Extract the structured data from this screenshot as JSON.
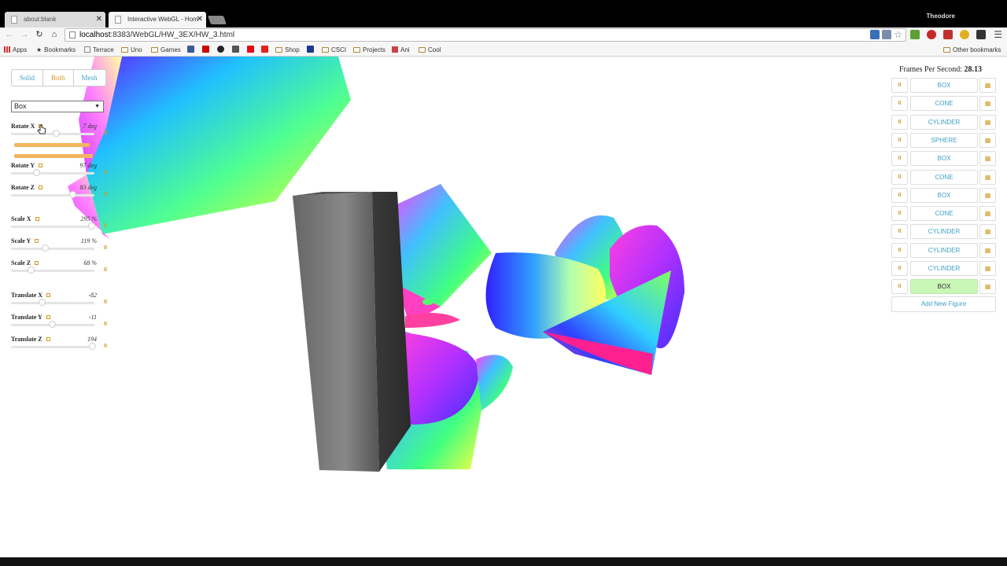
{
  "browser": {
    "tabs": [
      {
        "title": "about:blank",
        "active": false
      },
      {
        "title": "Interactive WebGL - Hom",
        "active": true
      }
    ],
    "user": "Theodore",
    "url_host": "localhost",
    "url_rest": ":8383/WebGL/HW_3EX/HW_3.html",
    "bookmarks": [
      "Apps",
      "Bookmarks",
      "Terrace",
      "Uno",
      "Games",
      "Shop",
      "CSCI",
      "Projects",
      "Ani",
      "Cool"
    ],
    "other_bookmarks": "Other bookmarks"
  },
  "controls": {
    "modes": [
      "Solid",
      "Both",
      "Mesh"
    ],
    "active_mode": "Both",
    "shape_select": "Box",
    "sliders": [
      {
        "label": "Rotate X",
        "value": "7 deg",
        "level": 0.52
      },
      {
        "label": "Rotate Y",
        "value": "97 deg",
        "level": 0.27
      },
      {
        "label": "Rotate Z",
        "value": "83 deg",
        "level": 0.73
      },
      {
        "label": "Scale X",
        "value": "295 %",
        "level": 0.96
      },
      {
        "label": "Scale Y",
        "value": "119 %",
        "level": 0.38
      },
      {
        "label": "Scale Z",
        "value": "68 %",
        "level": 0.21
      },
      {
        "label": "Translate X",
        "value": "-82",
        "level": 0.34
      },
      {
        "label": "Translate Y",
        "value": "-11",
        "level": 0.47
      },
      {
        "label": "Translate Z",
        "value": "194",
        "level": 0.97
      }
    ]
  },
  "right_panel": {
    "fps_label": "Frames Per Second:",
    "fps_value": "28.13",
    "figures": [
      "BOX",
      "CONE",
      "CYLINDER",
      "SPHERE",
      "BOX",
      "CONE",
      "BOX",
      "CONE",
      "CYLINDER",
      "CYLINDER",
      "CYLINDER",
      "BOX"
    ],
    "selected_index": 11,
    "add_button": "Add New Figure"
  },
  "colors": {
    "accent_blue": "#3fa0c6",
    "accent_orange": "#d39a22",
    "selected_green": "#c9f7b8"
  }
}
